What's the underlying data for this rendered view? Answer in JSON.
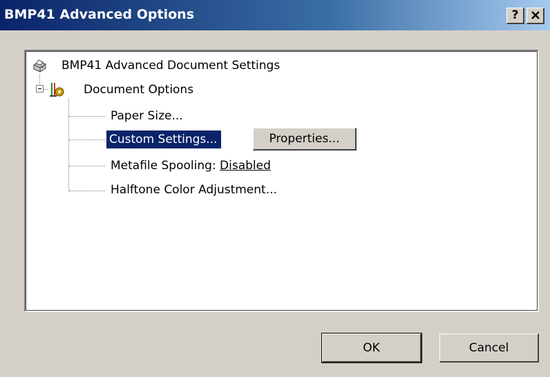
{
  "window": {
    "title": "BMP41 Advanced Options",
    "help_label": "?",
    "close_label": "✕",
    "title_bar_color": "#0a246a"
  },
  "tree": {
    "root": {
      "label": "BMP41 Advanced Document Settings",
      "icon": "printer-icon"
    },
    "document_options": {
      "label": "Document Options",
      "icon": "gear-options-icon",
      "expanded": true
    },
    "items": [
      {
        "label": "Paper Size..."
      },
      {
        "label": "Custom Settings...",
        "selected": true,
        "button_label": "Properties..."
      },
      {
        "label": "Metafile Spooling: ",
        "value": "Disabled"
      },
      {
        "label": "Halftone Color Adjustment..."
      }
    ]
  },
  "footer": {
    "ok_label": "OK",
    "cancel_label": "Cancel"
  },
  "colors": {
    "selection": "#0a246a",
    "face": "#d4d0c8"
  }
}
